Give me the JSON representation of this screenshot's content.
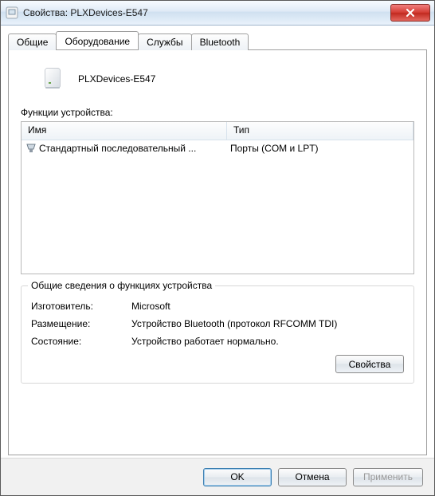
{
  "titlebar": {
    "text": "Свойства: PLXDevices-E547"
  },
  "tabs": [
    "Общие",
    "Оборудование",
    "Службы",
    "Bluetooth"
  ],
  "active_tab": 1,
  "device": {
    "name": "PLXDevices-E547"
  },
  "functions_label": "Функции устройства:",
  "columns": {
    "name": "Имя",
    "type": "Тип"
  },
  "rows": [
    {
      "name": "Стандартный последовательный ...",
      "type": "Порты (COM и LPT)"
    }
  ],
  "groupbox": {
    "title": "Общие сведения о функциях устройства",
    "manufacturer_label": "Изготовитель:",
    "manufacturer": "Microsoft",
    "location_label": "Размещение:",
    "location": "Устройство Bluetooth (протокол RFCOMM TDI)",
    "status_label": "Состояние:",
    "status": "Устройство работает нормально."
  },
  "buttons": {
    "properties": "Свойства",
    "ok": "OK",
    "cancel": "Отмена",
    "apply": "Применить"
  }
}
